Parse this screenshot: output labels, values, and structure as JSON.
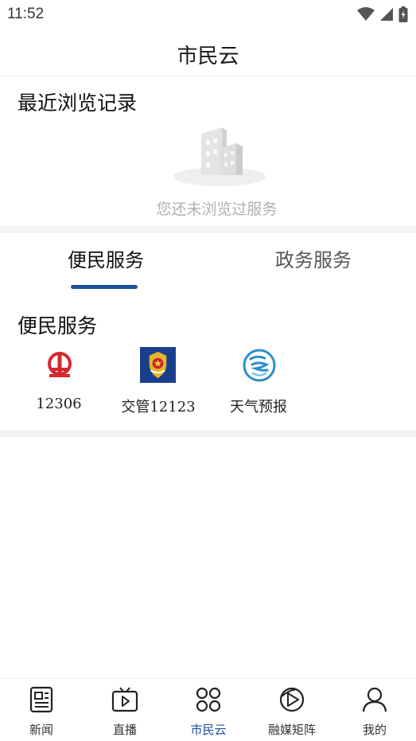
{
  "status_bar": {
    "time": "11:52",
    "icons": [
      "wifi-icon",
      "cellular-signal-icon",
      "battery-charging-icon"
    ]
  },
  "header": {
    "title": "市民云"
  },
  "recent": {
    "title": "最近浏览记录",
    "empty_text": "您还未浏览过服务",
    "illustration": "empty-buildings-illustration"
  },
  "tabs": [
    {
      "label": "便民服务",
      "active": true
    },
    {
      "label": "政务服务",
      "active": false
    }
  ],
  "services": {
    "title": "便民服务",
    "items": [
      {
        "label": "12306",
        "icon": "railway-logo-icon",
        "color": "#d7282f"
      },
      {
        "label": "交管12123",
        "icon": "police-emblem-icon",
        "color": "#1a3f8c"
      },
      {
        "label": "天气预报",
        "icon": "weather-logo-icon",
        "color": "#2a8fc9"
      }
    ]
  },
  "bottom_nav": [
    {
      "label": "新闻",
      "icon": "news-icon",
      "active": false
    },
    {
      "label": "直播",
      "icon": "tv-live-icon",
      "active": false
    },
    {
      "label": "市民云",
      "icon": "grid-apps-icon",
      "active": true
    },
    {
      "label": "融媒矩阵",
      "icon": "media-matrix-icon",
      "active": false
    },
    {
      "label": "我的",
      "icon": "user-profile-icon",
      "active": false
    }
  ],
  "colors": {
    "accent": "#1d4f99",
    "divider": "#f2f2f4",
    "muted_text": "#b0b0b0"
  }
}
